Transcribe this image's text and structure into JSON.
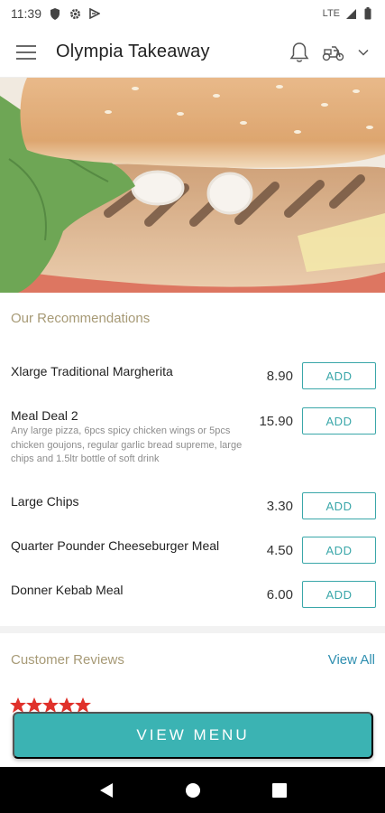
{
  "status_bar": {
    "time": "11:39",
    "network": "LTE",
    "icons": [
      "shield-icon",
      "gear-icon",
      "play-protect-icon",
      "wifi-icon",
      "signal-icon",
      "battery-icon"
    ]
  },
  "app_bar": {
    "title": "Olympia Takeaway",
    "icons": [
      "menu-icon",
      "bell-icon",
      "delivery-scooter-icon",
      "chevron-down-icon"
    ]
  },
  "recommendations": {
    "title": "Our Recommendations",
    "add_label": "ADD",
    "items": [
      {
        "name": "Xlarge Traditional Margherita",
        "description": "",
        "price": "8.90"
      },
      {
        "name": "Meal Deal 2",
        "description": "Any large pizza, 6pcs spicy chicken wings or 5pcs chicken goujons, regular garlic bread supreme, large chips and 1.5ltr bottle of soft drink",
        "price": "15.90"
      },
      {
        "name": "Large Chips",
        "description": "",
        "price": "3.30"
      },
      {
        "name": "Quarter Pounder Cheeseburger Meal",
        "description": "",
        "price": "4.50"
      },
      {
        "name": "Donner Kebab Meal",
        "description": "",
        "price": "6.00"
      }
    ]
  },
  "reviews": {
    "title": "Customer Reviews",
    "view_all": "View All"
  },
  "view_menu": "VIEW MENU",
  "colors": {
    "accent": "#3bb3b3",
    "section_title": "#a79a76",
    "link": "#2f8fb0",
    "star": "#e0312b"
  }
}
